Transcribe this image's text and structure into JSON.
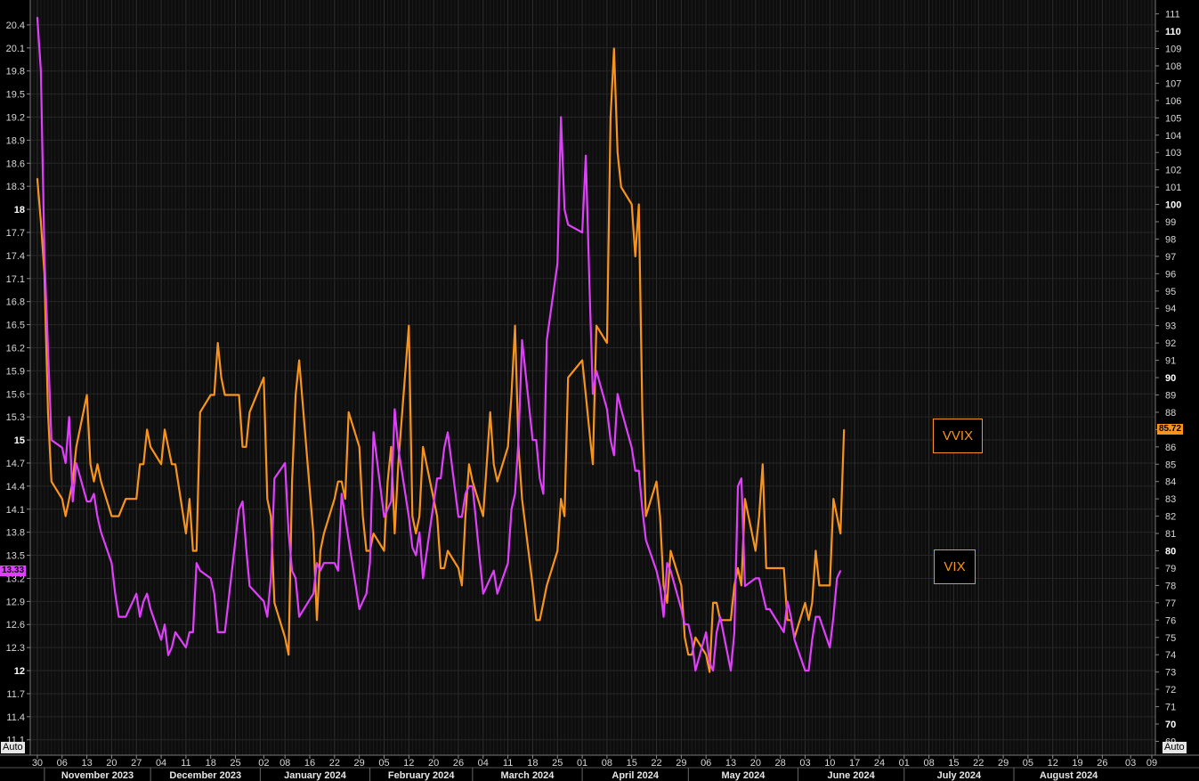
{
  "chart_data": {
    "type": "line",
    "x": [
      "2023-10-30",
      "2023-10-31",
      "2023-11-01",
      "2023-11-02",
      "2023-11-03",
      "2023-11-06",
      "2023-11-07",
      "2023-11-08",
      "2023-11-09",
      "2023-11-10",
      "2023-11-13",
      "2023-11-14",
      "2023-11-15",
      "2023-11-16",
      "2023-11-17",
      "2023-11-20",
      "2023-11-21",
      "2023-11-22",
      "2023-11-24",
      "2023-11-27",
      "2023-11-28",
      "2023-11-29",
      "2023-11-30",
      "2023-12-01",
      "2023-12-04",
      "2023-12-05",
      "2023-12-06",
      "2023-12-07",
      "2023-12-08",
      "2023-12-11",
      "2023-12-12",
      "2023-12-13",
      "2023-12-14",
      "2023-12-15",
      "2023-12-18",
      "2023-12-19",
      "2023-12-20",
      "2023-12-21",
      "2023-12-22",
      "2023-12-26",
      "2023-12-27",
      "2023-12-28",
      "2023-12-29",
      "2024-01-02",
      "2024-01-03",
      "2024-01-04",
      "2024-01-05",
      "2024-01-08",
      "2024-01-09",
      "2024-01-10",
      "2024-01-11",
      "2024-01-12",
      "2024-01-16",
      "2024-01-17",
      "2024-01-18",
      "2024-01-19",
      "2024-01-22",
      "2024-01-23",
      "2024-01-24",
      "2024-01-25",
      "2024-01-26",
      "2024-01-29",
      "2024-01-30",
      "2024-01-31",
      "2024-02-01",
      "2024-02-02",
      "2024-02-05",
      "2024-02-06",
      "2024-02-07",
      "2024-02-08",
      "2024-02-09",
      "2024-02-12",
      "2024-02-13",
      "2024-02-14",
      "2024-02-15",
      "2024-02-16",
      "2024-02-20",
      "2024-02-21",
      "2024-02-22",
      "2024-02-23",
      "2024-02-26",
      "2024-02-27",
      "2024-02-28",
      "2024-02-29",
      "2024-03-01",
      "2024-03-04",
      "2024-03-05",
      "2024-03-06",
      "2024-03-07",
      "2024-03-08",
      "2024-03-11",
      "2024-03-12",
      "2024-03-13",
      "2024-03-14",
      "2024-03-15",
      "2024-03-18",
      "2024-03-19",
      "2024-03-20",
      "2024-03-21",
      "2024-03-22",
      "2024-03-25",
      "2024-03-26",
      "2024-03-27",
      "2024-03-28",
      "2024-04-01",
      "2024-04-02",
      "2024-04-03",
      "2024-04-04",
      "2024-04-05",
      "2024-04-08",
      "2024-04-09",
      "2024-04-10",
      "2024-04-11",
      "2024-04-12",
      "2024-04-15",
      "2024-04-16",
      "2024-04-17",
      "2024-04-18",
      "2024-04-19",
      "2024-04-22",
      "2024-04-23",
      "2024-04-24",
      "2024-04-25",
      "2024-04-26",
      "2024-04-29",
      "2024-04-30",
      "2024-05-01",
      "2024-05-02",
      "2024-05-03",
      "2024-05-06",
      "2024-05-07",
      "2024-05-08",
      "2024-05-09",
      "2024-05-10",
      "2024-05-13",
      "2024-05-14",
      "2024-05-15",
      "2024-05-16",
      "2024-05-17",
      "2024-05-20",
      "2024-05-21",
      "2024-05-22",
      "2024-05-23",
      "2024-05-24",
      "2024-05-28",
      "2024-05-29",
      "2024-05-30",
      "2024-05-31",
      "2024-06-03",
      "2024-06-04",
      "2024-06-05",
      "2024-06-06",
      "2024-06-07",
      "2024-06-10",
      "2024-06-11",
      "2024-06-12",
      "2024-06-13",
      "2024-06-14",
      "2024-06-17",
      "2024-06-18",
      "2024-06-19",
      "2024-06-20",
      "2024-06-21"
    ],
    "series": [
      {
        "name": "VIX",
        "axis": "left",
        "color": "#e040fb",
        "values": [
          20.5,
          19.8,
          17.4,
          16.2,
          15.0,
          14.9,
          14.7,
          15.3,
          14.2,
          14.7,
          14.2,
          14.2,
          14.3,
          14.0,
          13.8,
          13.4,
          13.0,
          12.7,
          12.7,
          13.0,
          12.7,
          12.9,
          13.0,
          12.8,
          12.4,
          12.6,
          12.2,
          12.3,
          12.5,
          12.3,
          12.5,
          12.5,
          13.4,
          13.3,
          13.2,
          13.0,
          12.5,
          12.5,
          12.5,
          14.1,
          14.2,
          13.6,
          13.1,
          12.9,
          12.7,
          13.2,
          14.5,
          14.7,
          13.8,
          13.3,
          13.2,
          12.7,
          13.0,
          13.4,
          13.3,
          13.4,
          13.4,
          13.3,
          14.3,
          14.0,
          13.7,
          12.8,
          12.9,
          13.0,
          13.4,
          15.1,
          14.0,
          14.1,
          14.2,
          15.4,
          14.9,
          14.0,
          13.6,
          13.5,
          13.8,
          13.2,
          14.5,
          14.5,
          14.9,
          15.1,
          14.0,
          14.0,
          14.3,
          14.4,
          14.4,
          13.0,
          13.1,
          13.2,
          13.3,
          13.0,
          13.4,
          14.1,
          14.3,
          15.0,
          16.3,
          15.0,
          15.0,
          14.5,
          14.3,
          16.3,
          17.3,
          19.2,
          18.0,
          17.8,
          17.7,
          18.7,
          17.1,
          15.6,
          15.9,
          15.4,
          15.0,
          14.8,
          15.6,
          15.4,
          14.9,
          14.6,
          14.6,
          14.1,
          13.7,
          13.3,
          13.1,
          12.7,
          13.4,
          13.3,
          12.8,
          12.6,
          12.6,
          12.4,
          12.0,
          12.5,
          12.1,
          12.0,
          12.5,
          12.7,
          12.0,
          12.5,
          14.4,
          14.5,
          13.1,
          13.2,
          13.2,
          13.0,
          12.8,
          12.8,
          12.5,
          12.9,
          12.7,
          12.4,
          12.0,
          12.0,
          12.4,
          12.7,
          12.7,
          12.3,
          12.7,
          13.2,
          13.3
        ],
        "last_label": "13.33"
      },
      {
        "name": "VVIX",
        "axis": "right",
        "color": "#f7941d",
        "values": [
          101.5,
          99,
          96,
          88,
          84,
          83,
          82,
          83,
          84,
          86,
          89,
          85,
          84,
          85,
          84,
          82,
          82,
          82,
          83,
          83,
          85,
          85,
          87,
          86,
          85,
          87,
          86,
          85,
          85,
          81,
          83,
          80,
          80,
          88,
          89,
          89,
          92,
          90,
          89,
          89,
          86,
          86,
          88,
          90,
          83,
          82,
          77,
          75,
          74,
          84,
          89,
          91,
          81,
          76,
          80,
          81,
          83,
          84,
          84,
          83,
          88,
          86,
          82,
          80,
          80,
          81,
          80,
          84,
          86,
          81,
          85,
          93,
          82,
          81,
          82,
          86,
          82,
          79,
          79,
          80,
          79,
          78,
          82,
          85,
          84,
          82,
          85,
          88,
          85,
          84,
          86,
          89,
          93,
          86,
          83,
          78,
          76,
          76,
          77,
          78,
          80,
          83,
          82,
          90,
          91,
          89,
          87,
          85,
          93,
          92,
          105,
          109,
          103,
          101,
          100,
          97,
          100,
          88,
          82,
          84,
          82,
          78,
          77,
          80,
          78,
          75,
          74,
          74,
          75,
          74,
          73,
          77,
          77,
          76,
          76,
          78,
          79,
          78,
          83,
          80,
          82,
          85,
          79,
          79,
          79,
          76,
          76,
          75,
          77,
          76,
          77,
          80,
          78,
          78,
          83,
          82,
          81,
          87
        ],
        "last_label": "85.72"
      }
    ],
    "left_axis": {
      "ylim": [
        10.9,
        20.7
      ],
      "ticks": [
        "20.4",
        "20.1",
        "19.8",
        "19.5",
        "19.2",
        "18.9",
        "18.6",
        "18.3",
        "18",
        "17.7",
        "17.4",
        "17.1",
        "16.8",
        "16.5",
        "16.2",
        "15.9",
        "15.6",
        "15.3",
        "15",
        "14.7",
        "14.4",
        "14.1",
        "13.8",
        "13.5",
        "13.2",
        "12.9",
        "12.6",
        "12.3",
        "12",
        "11.7",
        "11.4",
        "11.1"
      ],
      "bold_ticks": [
        "18",
        "15",
        "12"
      ]
    },
    "right_axis": {
      "ylim": [
        68.2,
        111.7
      ],
      "ticks": [
        "111",
        "110",
        "109",
        "108",
        "107",
        "106",
        "105",
        "104",
        "103",
        "102",
        "101",
        "100",
        "99",
        "98",
        "97",
        "96",
        "95",
        "94",
        "93",
        "92",
        "91",
        "90",
        "89",
        "88",
        "87",
        "86",
        "85",
        "84",
        "83",
        "82",
        "81",
        "80",
        "79",
        "78",
        "77",
        "76",
        "75",
        "74",
        "73",
        "72",
        "71",
        "70",
        "69"
      ],
      "bold_ticks": [
        "110",
        "100",
        "90",
        "80",
        "70"
      ]
    },
    "x_axis": {
      "range": [
        "2023-10-28",
        "2024-09-10"
      ],
      "day_ticks": [
        {
          "date": "2023-10-30",
          "label": "30"
        },
        {
          "date": "2023-11-06",
          "label": "06"
        },
        {
          "date": "2023-11-13",
          "label": "13"
        },
        {
          "date": "2023-11-20",
          "label": "20"
        },
        {
          "date": "2023-11-27",
          "label": "27"
        },
        {
          "date": "2023-12-04",
          "label": "04"
        },
        {
          "date": "2023-12-11",
          "label": "11"
        },
        {
          "date": "2023-12-18",
          "label": "18"
        },
        {
          "date": "2023-12-25",
          "label": "25"
        },
        {
          "date": "2024-01-02",
          "label": "02"
        },
        {
          "date": "2024-01-08",
          "label": "08"
        },
        {
          "date": "2024-01-15",
          "label": "16"
        },
        {
          "date": "2024-01-22",
          "label": "22"
        },
        {
          "date": "2024-01-29",
          "label": "29"
        },
        {
          "date": "2024-02-05",
          "label": "05"
        },
        {
          "date": "2024-02-12",
          "label": "12"
        },
        {
          "date": "2024-02-19",
          "label": "20"
        },
        {
          "date": "2024-02-26",
          "label": "26"
        },
        {
          "date": "2024-03-04",
          "label": "04"
        },
        {
          "date": "2024-03-11",
          "label": "11"
        },
        {
          "date": "2024-03-18",
          "label": "18"
        },
        {
          "date": "2024-03-25",
          "label": "25"
        },
        {
          "date": "2024-04-01",
          "label": "01"
        },
        {
          "date": "2024-04-08",
          "label": "08"
        },
        {
          "date": "2024-04-15",
          "label": "15"
        },
        {
          "date": "2024-04-22",
          "label": "22"
        },
        {
          "date": "2024-04-29",
          "label": "29"
        },
        {
          "date": "2024-05-06",
          "label": "06"
        },
        {
          "date": "2024-05-13",
          "label": "13"
        },
        {
          "date": "2024-05-20",
          "label": "20"
        },
        {
          "date": "2024-05-27",
          "label": "28"
        },
        {
          "date": "2024-06-03",
          "label": "03"
        },
        {
          "date": "2024-06-10",
          "label": "10"
        },
        {
          "date": "2024-06-17",
          "label": "17"
        },
        {
          "date": "2024-06-24",
          "label": "24"
        },
        {
          "date": "2024-07-01",
          "label": "01"
        },
        {
          "date": "2024-07-08",
          "label": "08"
        },
        {
          "date": "2024-07-15",
          "label": "15"
        },
        {
          "date": "2024-07-22",
          "label": "22"
        },
        {
          "date": "2024-07-29",
          "label": "29"
        },
        {
          "date": "2024-08-05",
          "label": "05"
        },
        {
          "date": "2024-08-12",
          "label": "12"
        },
        {
          "date": "2024-08-19",
          "label": "19"
        },
        {
          "date": "2024-08-26",
          "label": "26"
        },
        {
          "date": "2024-09-03",
          "label": "03"
        },
        {
          "date": "2024-09-09",
          "label": "09"
        }
      ],
      "months": [
        {
          "start": "2023-11-01",
          "end": "2023-11-30",
          "label": "November 2023"
        },
        {
          "start": "2023-12-01",
          "end": "2023-12-31",
          "label": "December 2023"
        },
        {
          "start": "2024-01-01",
          "end": "2024-01-31",
          "label": "January 2024"
        },
        {
          "start": "2024-02-01",
          "end": "2024-02-29",
          "label": "February 2024"
        },
        {
          "start": "2024-03-01",
          "end": "2024-03-31",
          "label": "March 2024"
        },
        {
          "start": "2024-04-01",
          "end": "2024-04-30",
          "label": "April 2024"
        },
        {
          "start": "2024-05-01",
          "end": "2024-05-31",
          "label": "May 2024"
        },
        {
          "start": "2024-06-01",
          "end": "2024-06-30",
          "label": "June 2024"
        },
        {
          "start": "2024-07-01",
          "end": "2024-07-31",
          "label": "July 2024"
        },
        {
          "start": "2024-08-01",
          "end": "2024-08-31",
          "label": "August 2024"
        }
      ]
    },
    "grid": true,
    "legend": [
      {
        "label": "VVIX",
        "color": "#f7941d"
      },
      {
        "label": "VIX",
        "color": "#f7941d"
      }
    ],
    "auto_label_left": "Auto",
    "auto_label_right": "Auto"
  }
}
